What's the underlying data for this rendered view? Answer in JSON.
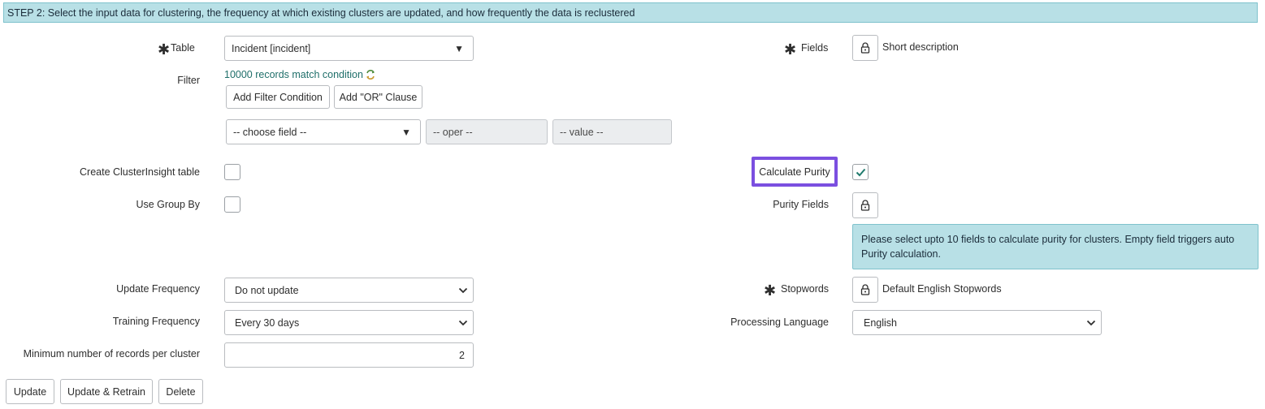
{
  "banner": {
    "text": "STEP 2: Select the input data for clustering, the frequency at which existing clusters are updated, and how frequently the data is reclustered"
  },
  "table": {
    "label": "Table",
    "value": "Incident [incident]"
  },
  "filter": {
    "label": "Filter",
    "match_text": "10000 records match condition",
    "add_condition": "Add Filter Condition",
    "add_or": "Add \"OR\" Clause",
    "choose_field": "-- choose field --",
    "oper": "-- oper --",
    "value": "-- value --"
  },
  "fields": {
    "label": "Fields",
    "value": "Short description"
  },
  "create_cluster_insight": {
    "label": "Create ClusterInsight table",
    "checked": false
  },
  "use_group_by": {
    "label": "Use Group By",
    "checked": false
  },
  "calculate_purity": {
    "label": "Calculate Purity",
    "checked": true
  },
  "purity_fields": {
    "label": "Purity Fields",
    "info": "Please select upto 10 fields to calculate purity for clusters. Empty field triggers auto Purity calculation."
  },
  "update_frequency": {
    "label": "Update Frequency",
    "value": "Do not update"
  },
  "training_frequency": {
    "label": "Training Frequency",
    "value": "Every 30 days"
  },
  "min_records": {
    "label": "Minimum number of records per cluster",
    "value": "2"
  },
  "stopwords": {
    "label": "Stopwords",
    "value": "Default English Stopwords"
  },
  "processing_language": {
    "label": "Processing Language",
    "value": "English"
  },
  "actions": {
    "update": "Update",
    "update_retrain": "Update & Retrain",
    "delete": "Delete"
  },
  "icons": {
    "lock": "lock-icon",
    "required": "asterisk-icon",
    "filter_refresh": "refresh-icon",
    "check": "check-icon",
    "chevron": "chevron-down-icon"
  },
  "colors": {
    "banner_bg": "#b8e0e6",
    "highlight_border": "#7b4fe0",
    "link": "#1f6f6a",
    "check": "#1f7a6d"
  }
}
